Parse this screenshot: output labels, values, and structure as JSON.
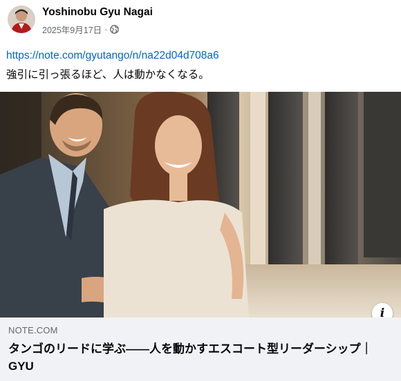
{
  "post": {
    "author": "Yoshinobu Gyu Nagai",
    "date": "2025年9月17日",
    "separator": "·",
    "privacy_icon": "globe-icon",
    "link_url": "https://note.com/gyutango/n/na22d04d708a6",
    "caption": "強引に引っ張るほど、人は動かなくなる。"
  },
  "link_card": {
    "domain": "NOTE.COM",
    "title": "タンゴのリードに学ぶ――人を動かすエスコート型リーダーシップ｜GYU",
    "info_icon": "info-icon",
    "info_label": "i",
    "image_alt": "smiling man in suit escorting smiling woman in cream dress"
  },
  "colors": {
    "link": "#0064d1",
    "secondary_text": "#65676b",
    "card_background": "#f0f2f5"
  }
}
